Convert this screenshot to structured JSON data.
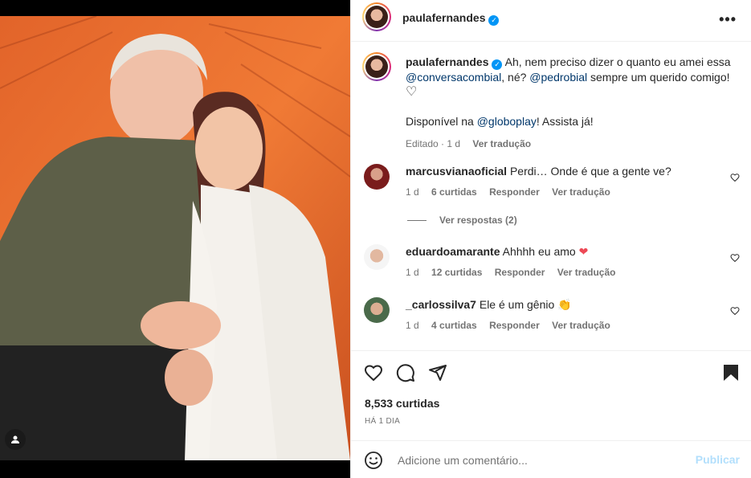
{
  "post": {
    "author": "paulafernandes",
    "verified": true,
    "photo_alt": "Foto de Paula Fernandes e Pedro Bial"
  },
  "header": {
    "username": "paulafernandes",
    "more_icon": "more-horizontal-icon"
  },
  "caption": {
    "username": "paulafernandes",
    "text_1": "Ah, nem preciso dizer o quanto eu amei essa",
    "mention_1": "@conversacombial",
    "text_2": ", né?",
    "mention_2": "@pedrobial",
    "text_3": "sempre um querido comigo!",
    "emoji": "♡",
    "text_4": "Disponível na",
    "mention_3": "@globoplay",
    "text_5": "! Assista já!",
    "edited": "Editado",
    "time": "1 d",
    "translate": "Ver tradução"
  },
  "comments": [
    {
      "username": "marcusvianaoficial",
      "text": "Perdi… Onde é que a gente ve?",
      "time": "1 d",
      "likes": "6 curtidas",
      "reply": "Responder",
      "translate": "Ver tradução",
      "avatar_color": "#7a1c1c"
    },
    {
      "username": "eduardoamarante",
      "text": "Ahhhh eu amo",
      "emoji": "❤",
      "time": "1 d",
      "likes": "12 curtidas",
      "reply": "Responder",
      "translate": "Ver tradução",
      "avatar_color": "#c9a48a"
    },
    {
      "username": "_carlossilva7",
      "text": "Ele é um gênio",
      "emoji": "👏",
      "time": "1 d",
      "likes": "4 curtidas",
      "reply": "Responder",
      "translate": "Ver tradução",
      "avatar_color": "#4a6a4a"
    }
  ],
  "view_replies": "Ver respostas (2)",
  "actions": {
    "likes": "8,533 curtidas",
    "time_ago": "HÁ 1 DIA"
  },
  "add_comment": {
    "placeholder": "Adicione um comentário...",
    "publish": "Publicar"
  },
  "colors": {
    "link": "#00376b",
    "muted": "#737373",
    "publish_disabled": "#b2dffc",
    "verified": "#0095f6",
    "heart_red": "#ed4956"
  }
}
